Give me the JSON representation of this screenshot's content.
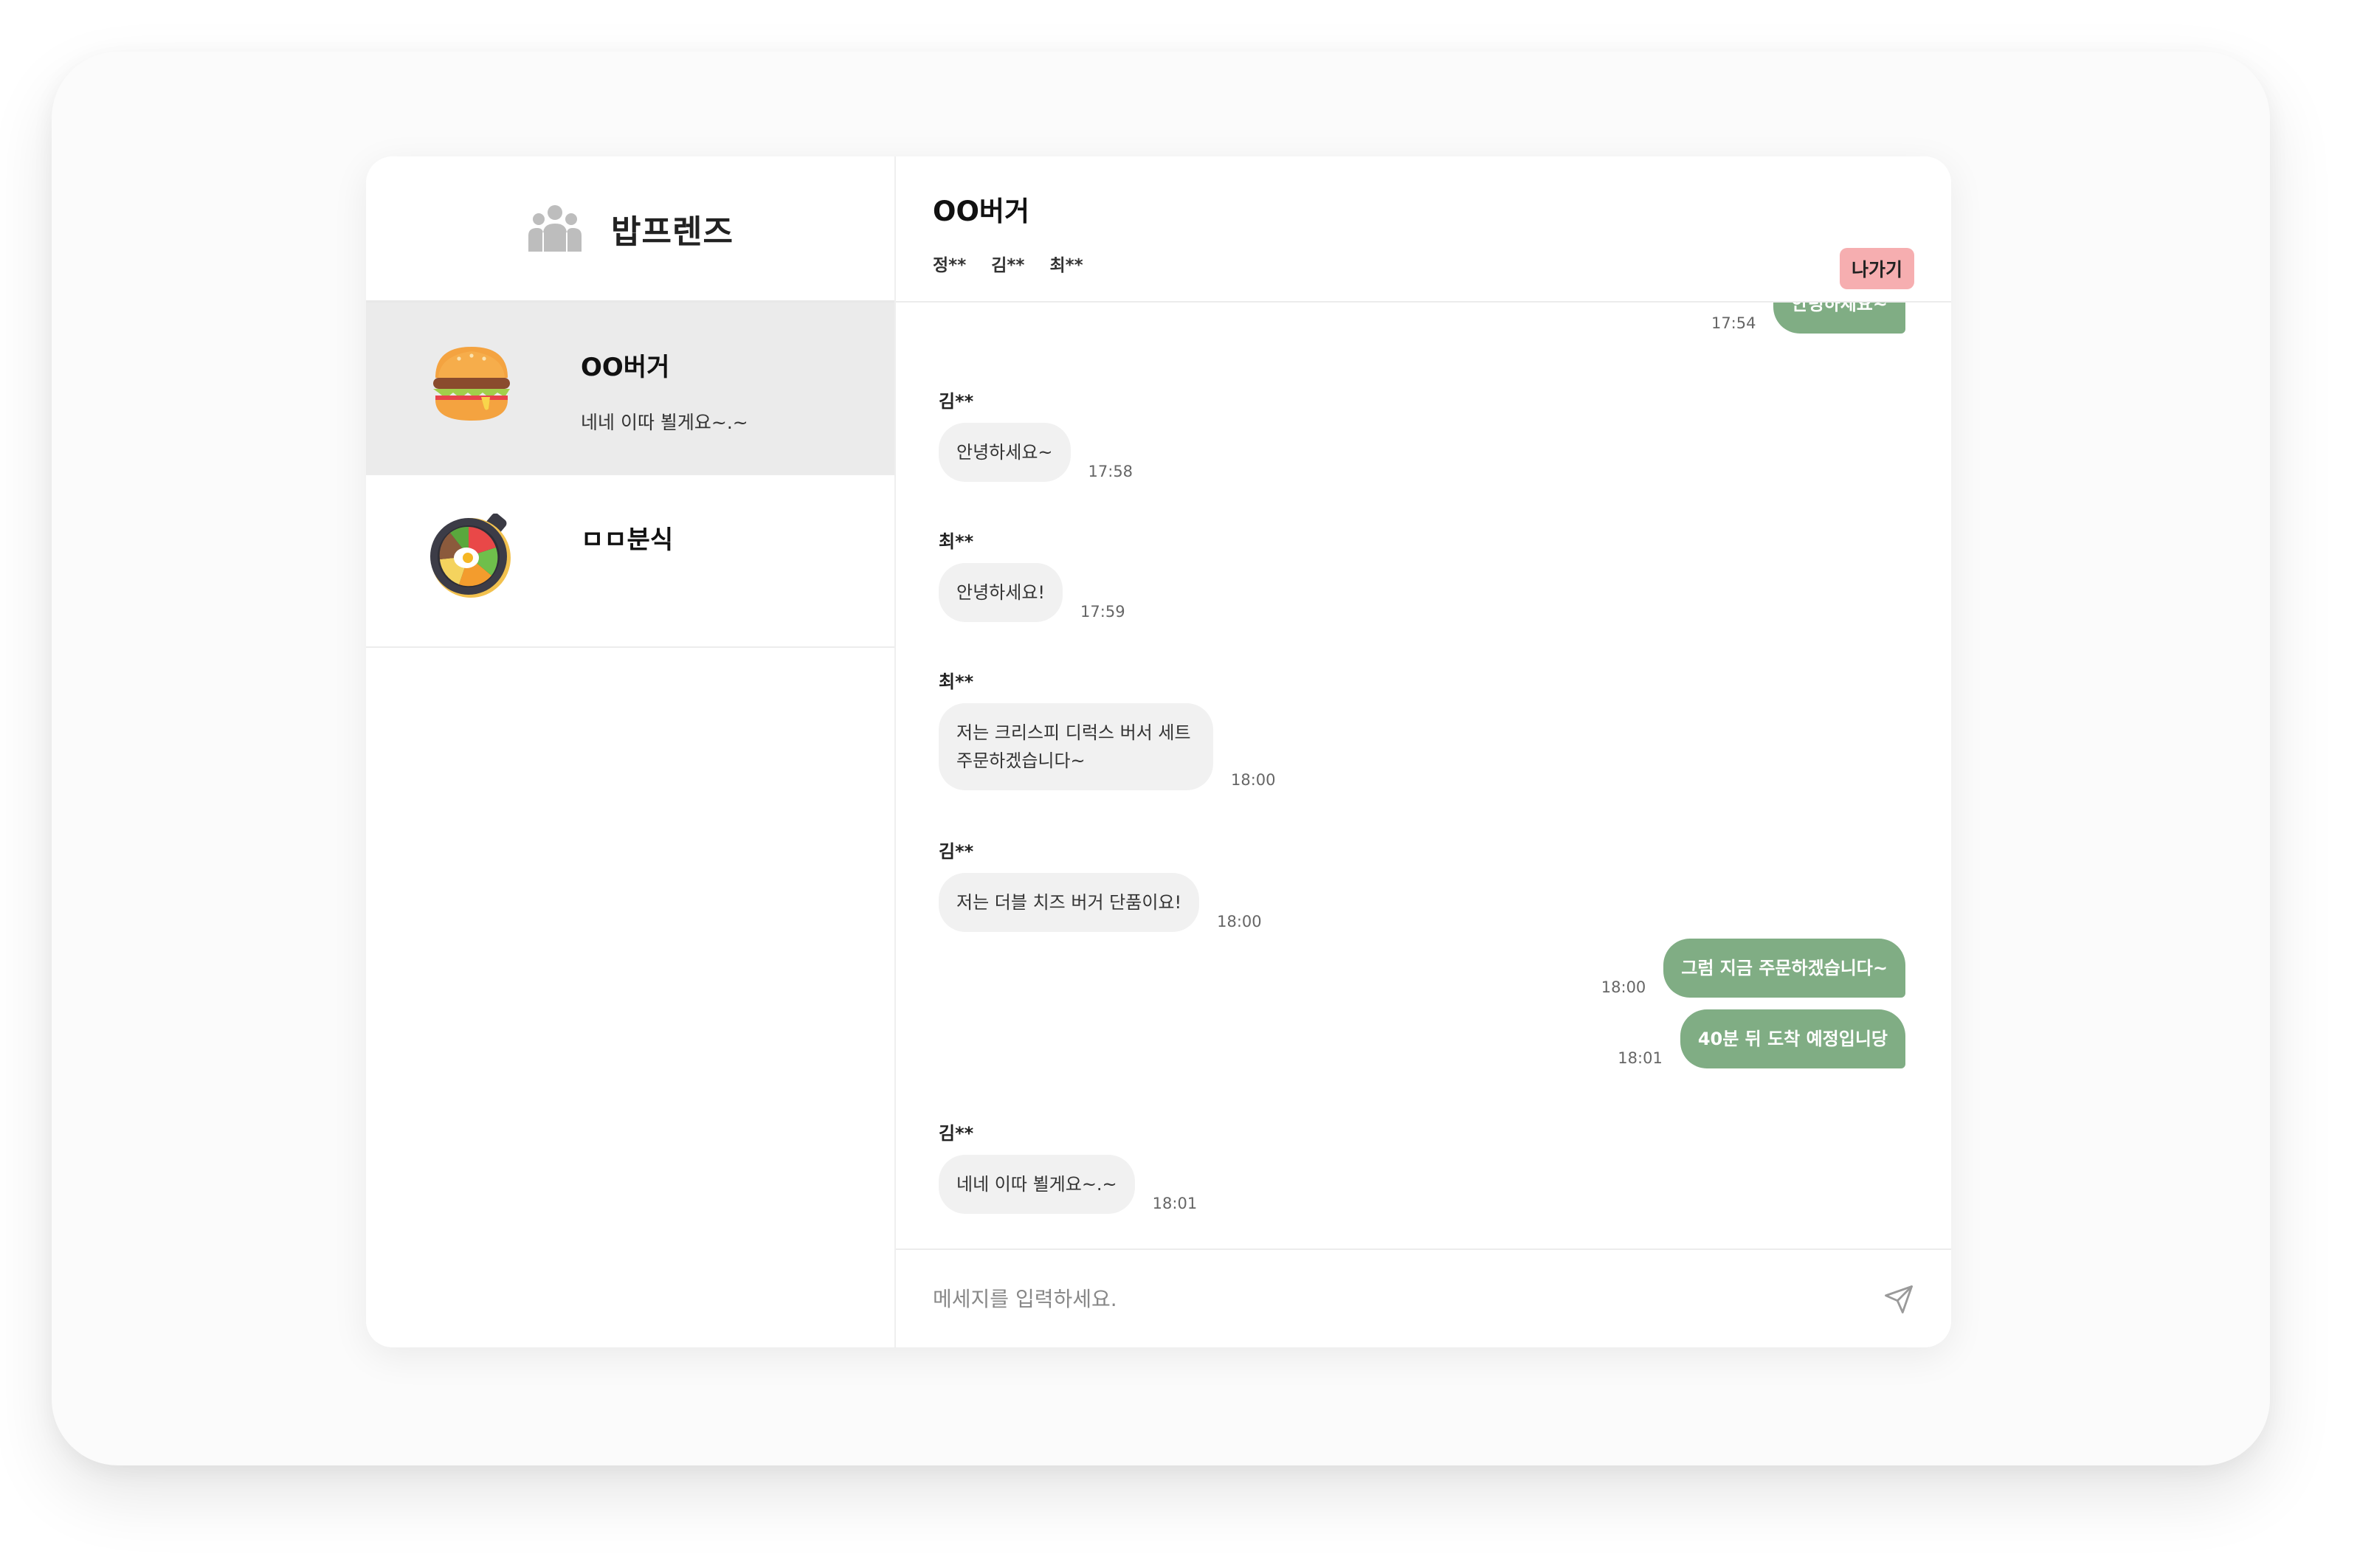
{
  "brand": {
    "name": "밥프렌즈",
    "icon": "group-icon"
  },
  "rooms": [
    {
      "title": "OO버거",
      "last_message": "네네 이따 뵐게요~.~",
      "icon": "burger-icon",
      "active": true
    },
    {
      "title": "ㅁㅁ분식",
      "last_message": "",
      "icon": "bibimbap-icon",
      "active": false
    }
  ],
  "chat": {
    "title": "OO버거",
    "members": [
      "정**",
      "김**",
      "최**"
    ],
    "leave_label": "나가기",
    "messages": [
      {
        "mine": true,
        "text": "안녕하세요~",
        "time": "17:54"
      },
      {
        "mine": false,
        "sender": "김**",
        "text": "안녕하세요~",
        "time": "17:58"
      },
      {
        "mine": false,
        "sender": "최**",
        "text": "안녕하세요!",
        "time": "17:59"
      },
      {
        "mine": false,
        "sender": "최**",
        "text": "저는 크리스피 디럭스 버서 세트 주문하겠습니다~",
        "time": "18:00"
      },
      {
        "mine": false,
        "sender": "김**",
        "text": "저는 더블 치즈 버거 단품이요!",
        "time": "18:00"
      },
      {
        "mine": true,
        "text": "그럼 지금 주문하겠습니다~",
        "time": "18:00"
      },
      {
        "mine": true,
        "text": "40분 뒤 도착 예정입니당",
        "time": "18:01"
      },
      {
        "mine": false,
        "sender": "김**",
        "text": "네네 이따 뵐게요~.~",
        "time": "18:01"
      }
    ],
    "input_placeholder": "메세지를 입력하세요.",
    "send_icon": "send-icon"
  },
  "colors": {
    "my_bubble": "#80ad84",
    "other_bubble": "#f1f1f1",
    "leave_button": "#f6aeb0",
    "active_room": "#ebebeb"
  }
}
